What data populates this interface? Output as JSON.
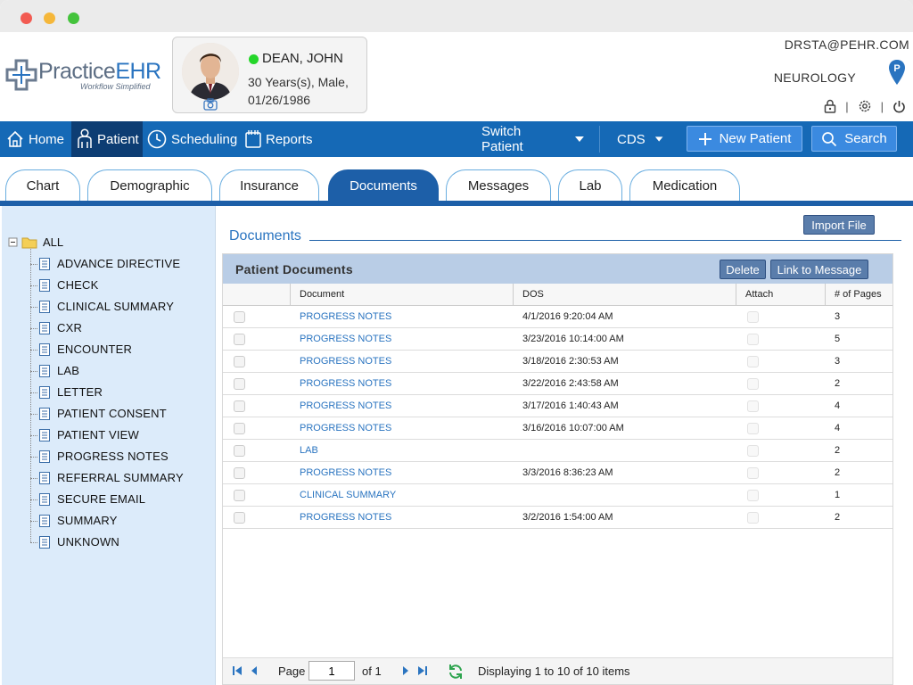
{
  "app": {
    "logo_main": "Practice",
    "logo_accent": "EHR",
    "logo_tagline": "Workflow Simplified"
  },
  "patient": {
    "name": "DEAN, JOHN",
    "age_gender": "30 Years(s), Male,",
    "dob": "01/26/1986",
    "status_color": "#25d62a"
  },
  "user": {
    "email": "DRSTA@PEHR.COM",
    "department": "NEUROLOGY",
    "icons": [
      "lock-icon",
      "gear-icon",
      "power-icon"
    ],
    "separator": "|"
  },
  "nav": {
    "items": [
      {
        "label": "Home",
        "icon": "home-icon"
      },
      {
        "label": "Patient",
        "icon": "patient-icon"
      },
      {
        "label": "Scheduling",
        "icon": "clock-icon"
      },
      {
        "label": "Reports",
        "icon": "calendar-icon"
      }
    ],
    "switch_patient": "Switch Patient",
    "cds": "CDS",
    "new_patient": "New Patient",
    "search": "Search"
  },
  "tabs": [
    {
      "label": "Chart"
    },
    {
      "label": "Demographic"
    },
    {
      "label": "Insurance"
    },
    {
      "label": "Documents",
      "active": true
    },
    {
      "label": "Messages"
    },
    {
      "label": "Lab"
    },
    {
      "label": "Medication"
    }
  ],
  "tree": {
    "root": "ALL",
    "items": [
      "ADVANCE DIRECTIVE",
      "CHECK",
      "CLINICAL SUMMARY",
      "CXR",
      "ENCOUNTER",
      "LAB",
      "LETTER",
      "PATIENT CONSENT",
      "PATIENT VIEW",
      "PROGRESS NOTES",
      "REFERRAL SUMMARY",
      "SECURE EMAIL",
      "SUMMARY",
      "UNKNOWN"
    ]
  },
  "documents": {
    "section_title": "Documents",
    "import_label": "Import File",
    "grid_title": "Patient Documents",
    "delete_label": "Delete",
    "link_label": "Link to Message",
    "columns": [
      "Document",
      "DOS",
      "Attach",
      "# of Pages"
    ],
    "rows": [
      {
        "document": "PROGRESS NOTES",
        "dos": "4/1/2016 9:20:04 AM",
        "pages": "3"
      },
      {
        "document": "PROGRESS NOTES",
        "dos": "3/23/2016 10:14:00 AM",
        "pages": "5"
      },
      {
        "document": "PROGRESS NOTES",
        "dos": "3/18/2016 2:30:53 AM",
        "pages": "3"
      },
      {
        "document": "PROGRESS NOTES",
        "dos": "3/22/2016 2:43:58 AM",
        "pages": "2"
      },
      {
        "document": "PROGRESS NOTES",
        "dos": "3/17/2016 1:40:43 AM",
        "pages": "4"
      },
      {
        "document": "PROGRESS NOTES",
        "dos": "3/16/2016 10:07:00 AM",
        "pages": "4"
      },
      {
        "document": "LAB",
        "dos": "",
        "pages": "2"
      },
      {
        "document": "PROGRESS NOTES",
        "dos": "3/3/2016 8:36:23 AM",
        "pages": "2"
      },
      {
        "document": "CLINICAL SUMMARY",
        "dos": "",
        "pages": "1"
      },
      {
        "document": "PROGRESS NOTES",
        "dos": "3/2/2016 1:54:00 AM",
        "pages": "2"
      }
    ],
    "pager": {
      "page_label": "Page",
      "page_value": "1",
      "of_label": "of 1",
      "display_text": "Displaying 1 to 10 of 10 items"
    }
  }
}
